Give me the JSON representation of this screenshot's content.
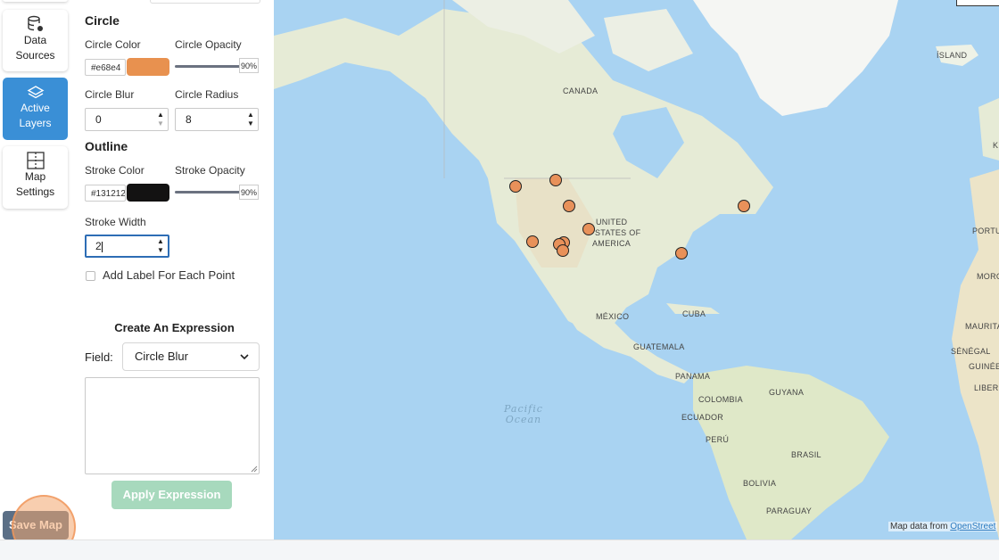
{
  "nav": {
    "items": [
      {
        "label_line1": "Data",
        "label_line2": "Sources",
        "icon": "database-gear-icon",
        "active": false
      },
      {
        "label_line1": "Active",
        "label_line2": "Layers",
        "icon": "layers-icon",
        "active": true
      },
      {
        "label_line1": "Map",
        "label_line2": "Settings",
        "icon": "grid-settings-icon",
        "active": false
      }
    ]
  },
  "panel": {
    "circle": {
      "title": "Circle",
      "color_label": "Circle Color",
      "color_hex": "#e68e4",
      "color_swatch": "#e8914f",
      "opacity_label": "Circle Opacity",
      "opacity_value": "90%",
      "blur_label": "Circle Blur",
      "blur_value": "0",
      "radius_label": "Circle Radius",
      "radius_value": "8"
    },
    "outline": {
      "title": "Outline",
      "stroke_color_label": "Stroke Color",
      "stroke_hex": "#131212",
      "stroke_swatch": "#131212",
      "stroke_opacity_label": "Stroke Opacity",
      "stroke_opacity_value": "90%",
      "stroke_width_label": "Stroke Width",
      "stroke_width_value": "2"
    },
    "label_checkbox": "Add Label For Each Point",
    "expression": {
      "title": "Create An Expression",
      "field_label": "Field:",
      "field_value": "Circle Blur",
      "apply_label": "Apply Expression"
    }
  },
  "save_label": "Save Map",
  "map": {
    "labels": {
      "canada": "CANADA",
      "usa1": "UNITED",
      "usa2": "STATES OF",
      "usa3": "AMERICA",
      "mexico": "MÉXICO",
      "cuba": "CUBA",
      "guatemala": "GUATEMALA",
      "panama": "PANAMA",
      "colombia": "COLOMBIA",
      "ecuador": "ECUADOR",
      "guyana": "GUYANA",
      "peru": "PERÚ",
      "brasil": "BRASIL",
      "bolivia": "BOLIVIA",
      "paraguay": "PARAGUAY",
      "island": "ÍSLAND",
      "portu": "PORTU",
      "moro": "MORO",
      "maurita": "MAURITA",
      "senegal": "SÉNÉGAL",
      "guinee": "GUINÉE",
      "liberi": "LIBERI",
      "k": "K",
      "pacific1": "Pacific",
      "pacific2": "Ocean"
    },
    "attribution_prefix": "Map data from",
    "attribution_link": "OpenStreet"
  }
}
